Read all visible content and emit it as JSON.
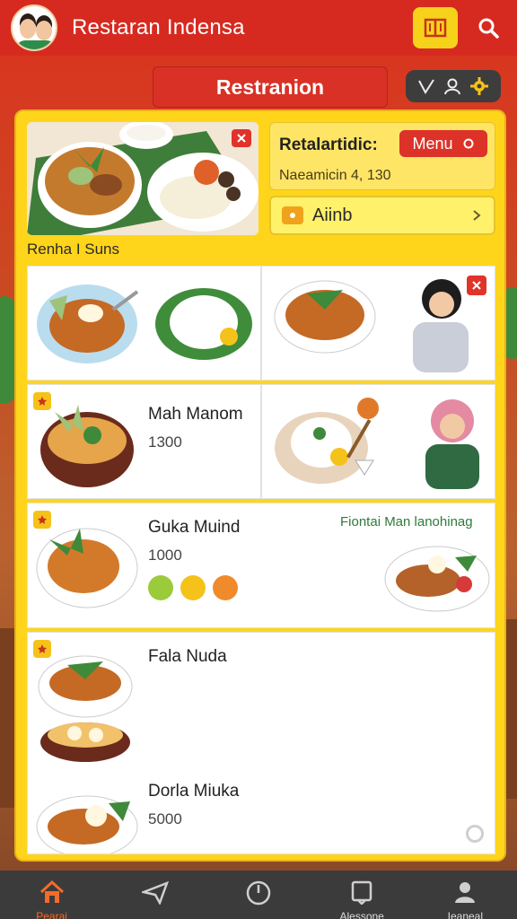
{
  "header": {
    "title": "Restaran Indensa",
    "menu_icon": "book-menu-icon",
    "search_icon": "search-icon"
  },
  "section_tab": {
    "label": "Restranion"
  },
  "controls": {
    "icons": [
      "check-icon",
      "user-icon",
      "gear-icon"
    ]
  },
  "featured": {
    "info_title": "Retalartidic:",
    "menu_button": "Menu",
    "info_subtitle": "Naeamicin 4, 130",
    "action_label": "Aiinb",
    "section_label": "Renha I Suns"
  },
  "dishes": [
    {
      "name": "Mah Manom",
      "price": "1300"
    },
    {
      "name": "Guka Muind",
      "price": "1000",
      "promo": "Fiontai Man lanohinag"
    },
    {
      "name": "Fala Nuda",
      "price": ""
    },
    {
      "name": "Dorla Miuka",
      "price": "5000"
    }
  ],
  "bottom_nav": [
    {
      "label": "Pearai",
      "icon": "home-icon",
      "active": true
    },
    {
      "label": "",
      "icon": "send-icon",
      "active": false
    },
    {
      "label": "",
      "icon": "clock-icon",
      "active": false
    },
    {
      "label": "Alessone",
      "icon": "bookmark-icon",
      "active": false
    },
    {
      "label": "Ieaneal",
      "icon": "profile-icon",
      "active": false
    }
  ],
  "colors": {
    "primary_red": "#d62a20",
    "accent_yellow": "#ffd51c",
    "nav_dark": "#3b3b3b",
    "active_orange": "#f36c2a"
  }
}
